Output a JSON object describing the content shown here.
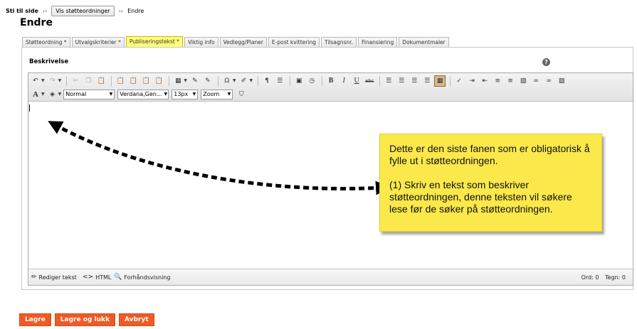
{
  "breadcrumb": {
    "title": "Sti til side",
    "separator": "››",
    "button_label": "Vis støtteordninger",
    "current": "Endre"
  },
  "page": {
    "title": "Endre"
  },
  "tabs": [
    {
      "label": "Støtteordning *",
      "active": false
    },
    {
      "label": "Utvalgskriterier *",
      "active": false
    },
    {
      "label": "Publiseringstekst *",
      "active": true
    },
    {
      "label": "Viktig info",
      "active": false
    },
    {
      "label": "Vedlegg/Planer",
      "active": false
    },
    {
      "label": "E-post kvittering",
      "active": false
    },
    {
      "label": "Tilsagnsnr.",
      "active": false
    },
    {
      "label": "Finansiering",
      "active": false
    },
    {
      "label": "Dokumentmaler",
      "active": false
    }
  ],
  "panel": {
    "label": "Beskrivelse",
    "help_icon": "help-icon"
  },
  "editor": {
    "format_select": "Normal",
    "font_select": "Verdana,Gen...",
    "size_select": "13px",
    "zoom_select": "Zoom",
    "content": "",
    "modes": {
      "edit": "Rediger tekst",
      "html": "HTML",
      "preview": "Forhåndsvisning"
    },
    "word_count": "Ord: 0",
    "char_count": "Tegn: 0"
  },
  "callout": {
    "line1": "Dette er den siste fanen som er obligatorisk å fylle ut i støtteordningen.",
    "line2": "(1) Skriv en tekst som beskriver støtteordningen, denne teksten vil søkere lese før de søker på støtteordningen."
  },
  "actions": {
    "save": "Lagre",
    "save_close": "Lagre og lukk",
    "cancel": "Avbryt"
  },
  "colors": {
    "accent_button": "#f15a24",
    "active_tab": "#ffff7a",
    "callout": "#fbe84a"
  }
}
